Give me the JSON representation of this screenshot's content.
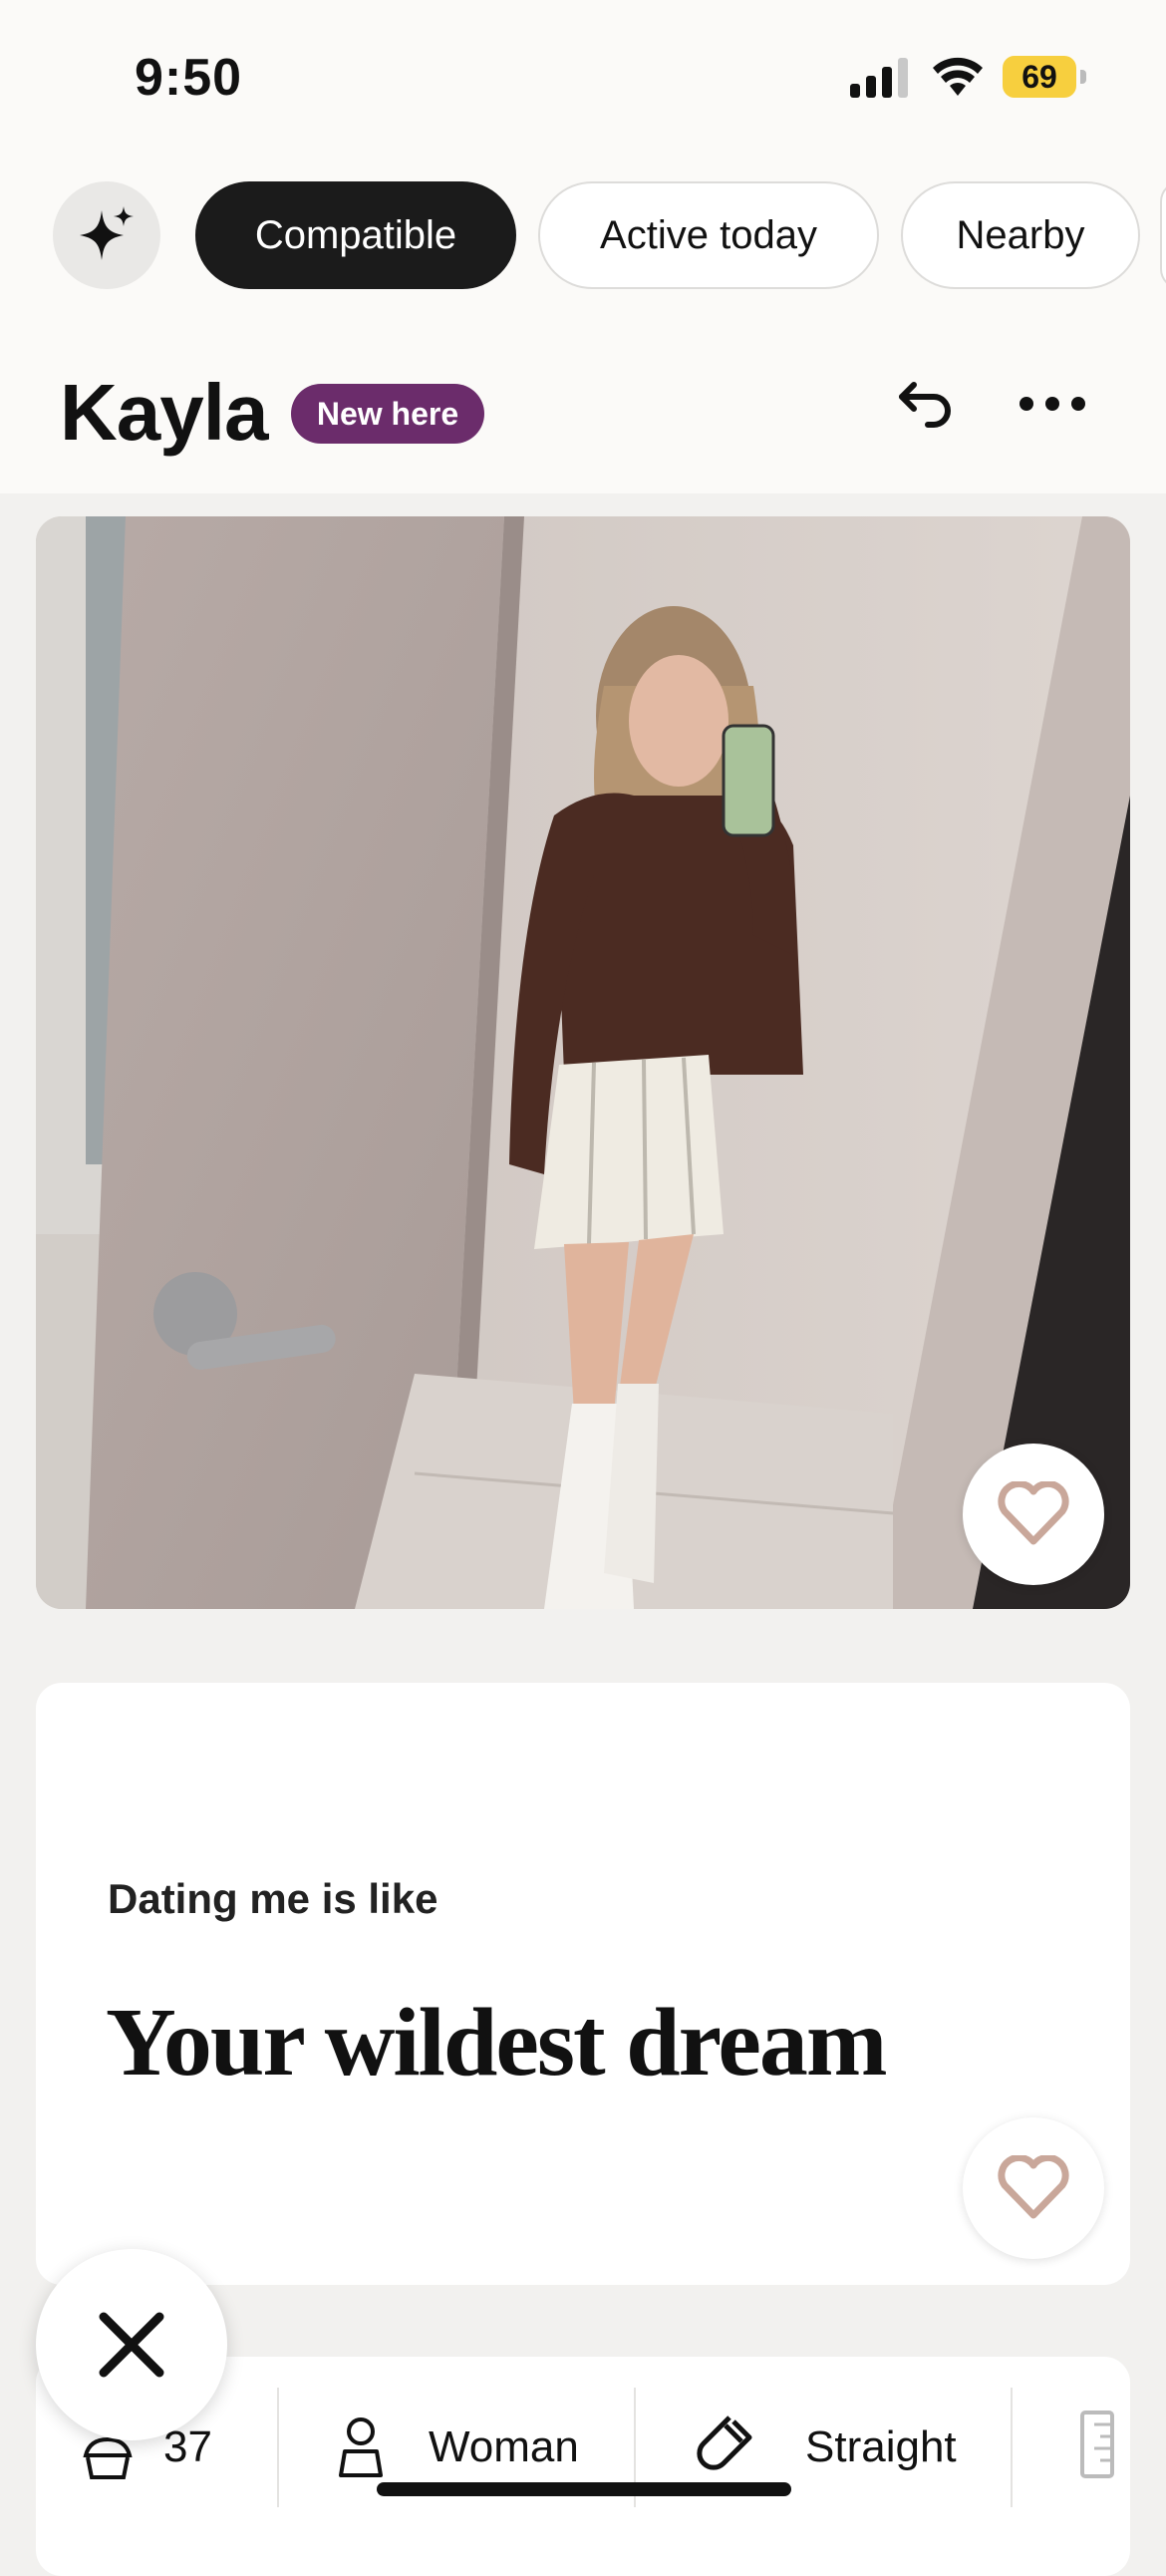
{
  "status_bar": {
    "time": "9:50",
    "battery": "69"
  },
  "filters": {
    "sparkle_icon": "sparkle-icon",
    "chips": [
      {
        "label": "Compatible",
        "active": true
      },
      {
        "label": "Active today",
        "active": false
      },
      {
        "label": "Nearby",
        "active": false
      }
    ]
  },
  "profile": {
    "name": "Kayla",
    "badge": "New here",
    "badge_color": "#6b2c6b"
  },
  "prompt": {
    "question": "Dating me is like",
    "answer": "Your wildest dream"
  },
  "info": {
    "age": "37",
    "gender": "Woman",
    "orientation": "Straight"
  },
  "colors": {
    "accent": "#1b1b1b",
    "heart": "#c9a79a",
    "background": "#f2f1ef"
  }
}
